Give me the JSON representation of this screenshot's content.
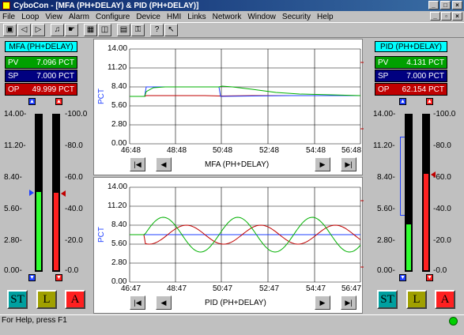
{
  "window": {
    "title": "CyboCon - [MFA (PH+DELAY) & PID (PH+DELAY)]"
  },
  "menu": [
    "File",
    "Loop",
    "View",
    "Alarm",
    "Configure",
    "Device",
    "HMI",
    "Links",
    "Network",
    "Window",
    "Security",
    "Help"
  ],
  "toolbar": {
    "icons": [
      "film-icon",
      "back-arrow-icon",
      "forward-arrow-icon",
      "bell-icon",
      "hand-icon",
      "grid-icon",
      "two-pane-icon",
      "lock-icon",
      "key-icon",
      "help-icon",
      "pointer-help-icon"
    ]
  },
  "left_loop": {
    "title": "MFA (PH+DELAY)",
    "pv": {
      "label": "PV",
      "value": "7.096 PCT"
    },
    "sp": {
      "label": "SP",
      "value": "7.000 PCT"
    },
    "op": {
      "label": "OP",
      "value": "49.999 PCT"
    },
    "left_scale": [
      "14.00-",
      "11.20-",
      "8.40-",
      "5.60-",
      "2.80-",
      "0.00-"
    ],
    "right_scale": [
      "-100.0",
      "-80.0",
      "-60.0",
      "-40.0",
      "-20.0",
      "-0.0"
    ],
    "pv_level": 0.507,
    "op_level": 0.5,
    "buttons": {
      "st": "ST",
      "l": "L",
      "a": "A"
    }
  },
  "right_loop": {
    "title": "PID (PH+DELAY)",
    "pv": {
      "label": "PV",
      "value": "4.131 PCT"
    },
    "sp": {
      "label": "SP",
      "value": "7.000 PCT"
    },
    "op": {
      "label": "OP",
      "value": "62.154 PCT"
    },
    "left_scale": [
      "14.00-",
      "11.20-",
      "8.40-",
      "5.60-",
      "2.80-",
      "0.00-"
    ],
    "right_scale": [
      "-100.0",
      "-80.0",
      "-60.0",
      "-40.0",
      "-20.0",
      "-0.0"
    ],
    "pv_level": 0.295,
    "op_level": 0.622,
    "buttons": {
      "st": "ST",
      "l": "L",
      "a": "A"
    }
  },
  "trend_top": {
    "ylabel": "PCT",
    "yticks": [
      "14.00",
      "11.20",
      "8.40",
      "5.60",
      "2.80",
      "0.00"
    ],
    "xticks": [
      "46:48",
      "48:48",
      "50:48",
      "52:48",
      "54:48",
      "56:48"
    ],
    "caption": "MFA (PH+DELAY)"
  },
  "trend_bottom": {
    "ylabel": "PCT",
    "yticks": [
      "14.00",
      "11.20",
      "8.40",
      "5.60",
      "2.80",
      "0.00"
    ],
    "xticks": [
      "46:47",
      "48:47",
      "50:47",
      "52:47",
      "54:47",
      "56:47"
    ],
    "caption": "PID (PH+DELAY)"
  },
  "status": {
    "text": "For Help, press F1"
  },
  "colors": {
    "pv": "#00a000",
    "sp": "#000080",
    "op": "#c00000",
    "title_bg": "#00ffff"
  }
}
